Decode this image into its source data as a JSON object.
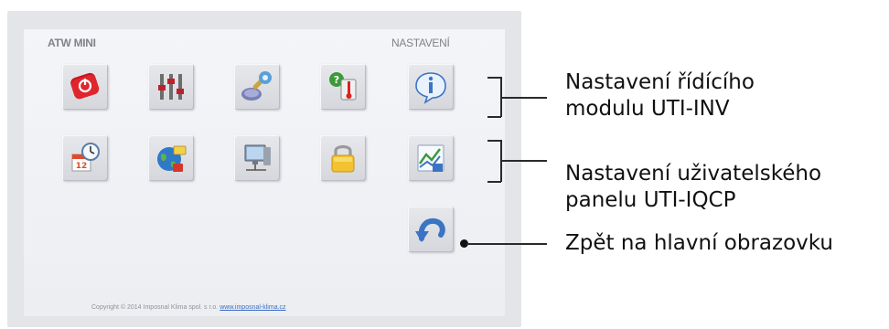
{
  "screen": {
    "app_title": "ATW MINI",
    "section_title": "NASTAVENÍ",
    "copyright_text": "Copyright © 2014 Imposnal Klima spol. s r.o.",
    "copyright_link": "www.imposnal-klima.cz"
  },
  "tiles": [
    {
      "name": "power-icon",
      "icon": "power-icon"
    },
    {
      "name": "sliders-icon",
      "icon": "sliders-icon"
    },
    {
      "name": "wrench-settings-icon",
      "icon": "wrench-settings-icon"
    },
    {
      "name": "thermometer-check-icon",
      "icon": "thermometer-check-icon"
    },
    {
      "name": "info-icon",
      "icon": "info-icon"
    },
    {
      "name": "calendar-clock-icon",
      "icon": "calendar-clock-icon"
    },
    {
      "name": "globe-network-icon",
      "icon": "globe-network-icon"
    },
    {
      "name": "computer-network-icon",
      "icon": "computer-network-icon"
    },
    {
      "name": "padlock-icon",
      "icon": "padlock-icon"
    },
    {
      "name": "chart-save-icon",
      "icon": "chart-save-icon"
    },
    {
      "name": "back-arrow-icon",
      "icon": "back-arrow-icon"
    }
  ],
  "annotations": {
    "controller_settings": {
      "line1": "Nastavení řídícího",
      "line2": "modulu UTI-INV"
    },
    "user_panel_settings": {
      "line1": "Nastavení uživatelského",
      "line2": "panelu UTI-IQCP"
    },
    "back_to_main": {
      "line1": "Zpět na hlavní obrazovku"
    }
  },
  "colors": {
    "panel_bg": "#eceef2",
    "frame_bg": "#e3e5e9",
    "link": "#3b6dc7",
    "label_gray": "#7f8388"
  }
}
